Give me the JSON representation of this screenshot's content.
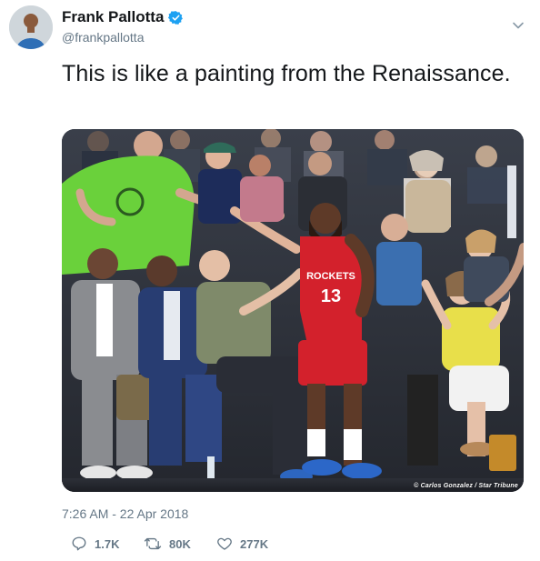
{
  "user": {
    "display_name": "Frank Pallotta",
    "handle": "@frankpallotta",
    "verified": true,
    "avatar_icon": "profile-photo"
  },
  "tweet": {
    "text": "This is like a painting from the Renaissance.",
    "media_credit": "© Carlos Gonzalez / Star Tribune",
    "timestamp": "7:26 AM - 22 Apr 2018"
  },
  "actions": {
    "reply_count": "1.7K",
    "retweet_count": "80K",
    "like_count": "277K"
  },
  "icons": {
    "verified": "verified-badge-icon",
    "caret": "chevron-down-icon",
    "reply": "reply-icon",
    "retweet": "retweet-icon",
    "like": "heart-icon"
  },
  "colors": {
    "verified": "#1da1f2",
    "muted_text": "#657786",
    "primary_text": "#14171a",
    "jersey_red": "#d3212c"
  }
}
